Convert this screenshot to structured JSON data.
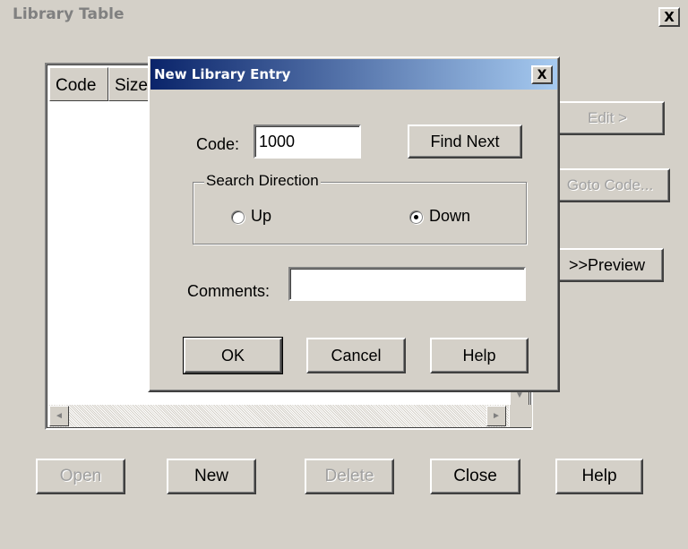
{
  "window": {
    "title": "Library Table",
    "close_glyph": "X"
  },
  "list": {
    "columns": [
      "Code",
      "Size"
    ],
    "scroll_left_glyph": "◄",
    "scroll_right_glyph": "►",
    "scroll_down_glyph": "▼"
  },
  "side_buttons": {
    "edit": "Edit >",
    "goto": "Goto Code...",
    "preview": ">>Preview"
  },
  "bottom_buttons": {
    "open": "Open",
    "new": "New",
    "delete": "Delete",
    "close": "Close",
    "help": "Help"
  },
  "dialog": {
    "title": "New Library Entry",
    "close_glyph": "X",
    "code_label": "Code:",
    "code_value": "1000",
    "find_next": "Find Next",
    "search_direction": "Search Direction",
    "radio_up": "Up",
    "radio_down": "Down",
    "selected_direction": "Down",
    "comments_label": "Comments:",
    "comments_value": "",
    "ok": "OK",
    "cancel": "Cancel",
    "help": "Help"
  }
}
